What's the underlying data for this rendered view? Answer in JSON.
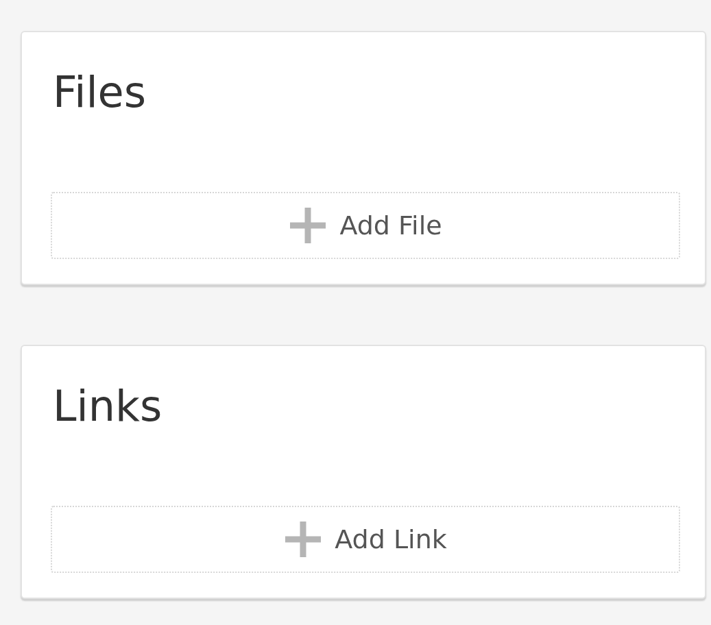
{
  "sections": [
    {
      "title": "Files",
      "button": {
        "label": "Add File"
      }
    },
    {
      "title": "Links",
      "button": {
        "label": "Add Link"
      }
    }
  ]
}
